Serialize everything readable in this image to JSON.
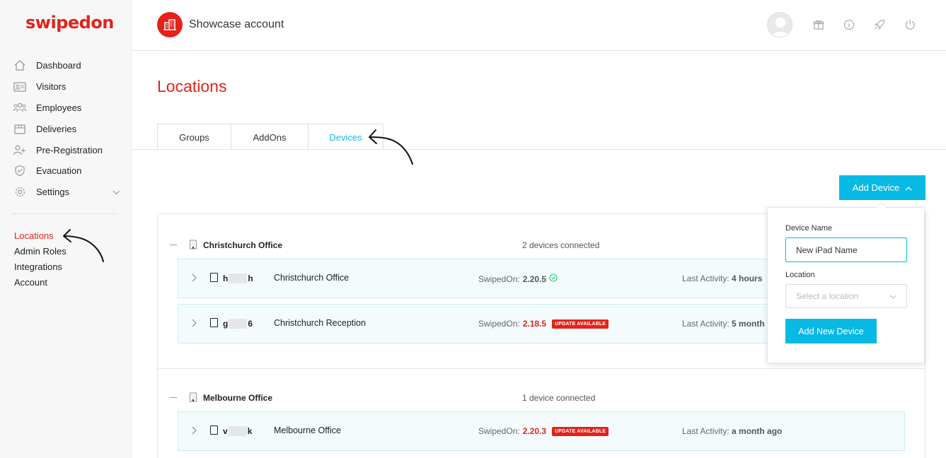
{
  "brand": {
    "logo_text": "swipedon",
    "accent": "#e3231b",
    "primary": "#08b9e3"
  },
  "sidebar": {
    "items": [
      {
        "label": "Dashboard",
        "icon": "home-icon"
      },
      {
        "label": "Visitors",
        "icon": "visitor-card-icon"
      },
      {
        "label": "Employees",
        "icon": "users-icon"
      },
      {
        "label": "Deliveries",
        "icon": "box-icon"
      },
      {
        "label": "Pre-Registration",
        "icon": "user-plus-icon"
      },
      {
        "label": "Evacuation",
        "icon": "shield-icon"
      },
      {
        "label": "Settings",
        "icon": "gear-icon"
      }
    ],
    "sub_items": [
      "Locations",
      "Admin Roles",
      "Integrations",
      "Account"
    ]
  },
  "header": {
    "account_name": "Showcase account"
  },
  "page": {
    "title": "Locations"
  },
  "tabs": [
    {
      "label": "Groups"
    },
    {
      "label": "AddOns"
    },
    {
      "label": "Devices"
    }
  ],
  "add_device": {
    "label": "Add Device"
  },
  "locations": [
    {
      "name": "Christchurch Office",
      "count": "2 devices connected",
      "devices": [
        {
          "id_start": "h",
          "id_end": "h",
          "name": "Christchurch Office",
          "version_label": "SwipedOn:",
          "version": "2.20.5",
          "badge": "",
          "activity_label": "Last Activity:",
          "activity": "4 hours"
        },
        {
          "id_start": "g",
          "id_end": "6",
          "name": "Christchurch Reception",
          "version_label": "SwipedOn:",
          "version": "2.18.5",
          "badge": "UPDATE AVAILABLE",
          "activity_label": "Last Activity:",
          "activity": "5 month"
        }
      ]
    },
    {
      "name": "Melbourne Office",
      "count": "1 device connected",
      "devices": [
        {
          "id_start": "v",
          "id_end": "k",
          "name": "Melbourne Office",
          "version_label": "SwipedOn:",
          "version": "2.20.3",
          "badge": "UPDATE AVAILABLE",
          "activity_label": "Last Activity:",
          "activity": "a month ago"
        }
      ]
    }
  ],
  "form": {
    "device_name_label": "Device Name",
    "device_name_value": "New iPad Name",
    "location_label": "Location",
    "location_placeholder": "Select a location",
    "submit_label": "Add New Device"
  }
}
